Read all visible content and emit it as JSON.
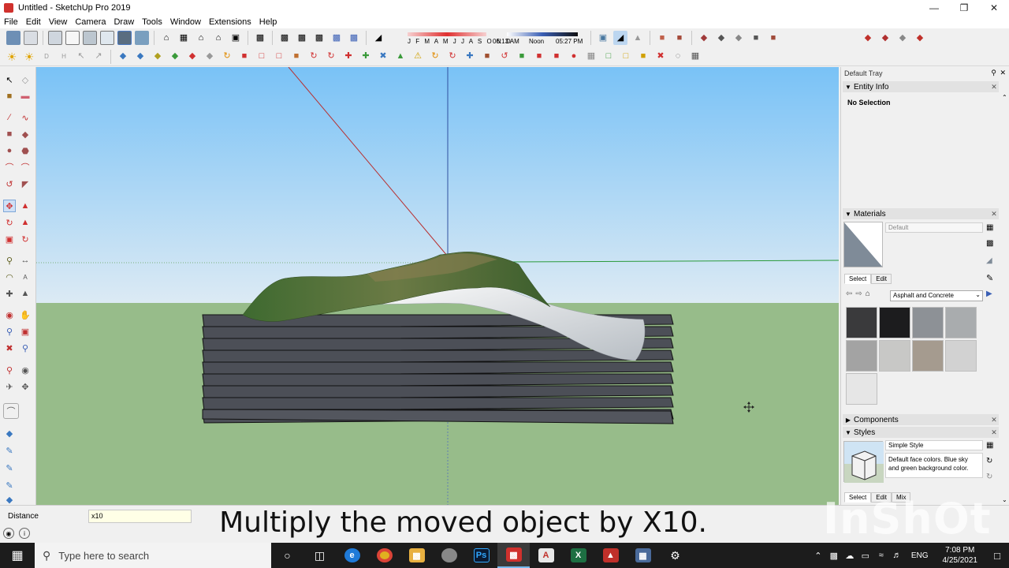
{
  "window": {
    "title": "Untitled - SketchUp Pro 2019"
  },
  "menu": [
    "File",
    "Edit",
    "View",
    "Camera",
    "Draw",
    "Tools",
    "Window",
    "Extensions",
    "Help"
  ],
  "shadow_settings": {
    "months": "J F M A M J J A S O N D",
    "time_start": "06:13 AM",
    "time_noon": "Noon",
    "time_end": "05:27 PM"
  },
  "tray": {
    "title": "Default Tray",
    "entity_info": {
      "title": "Entity Info",
      "selection": "No Selection"
    },
    "materials": {
      "title": "Materials",
      "current": "Default",
      "tab_select": "Select",
      "tab_edit": "Edit",
      "library": "Asphalt and Concrete",
      "swatch_colors": [
        "#3a3a3c",
        "#1c1c1e",
        "#8d9196",
        "#a9acae",
        "#a3a3a3",
        "#c8c8c6",
        "#a59b8f",
        "#d2d2d2",
        "#e6e6e6"
      ]
    },
    "components": {
      "title": "Components"
    },
    "styles": {
      "title": "Styles",
      "name": "Simple Style",
      "description": "Default face colors. Blue sky and green background color.",
      "tab_select": "Select",
      "tab_edit": "Edit",
      "tab_mix": "Mix"
    }
  },
  "measurements": {
    "label": "Distance",
    "value": "x10"
  },
  "caption": "Multiply the moved object by X10.",
  "watermark": "InShOt",
  "taskbar": {
    "search_placeholder": "Type here to search",
    "language": "ENG",
    "time": "7:08 PM",
    "date": "4/25/2021"
  },
  "colors": {
    "sky_top": "#7cc4f6",
    "sky_bottom": "#dbeaf5",
    "ground": "#97bc8a",
    "slab": "#4c4f57",
    "terrain": "#4a6e36"
  }
}
